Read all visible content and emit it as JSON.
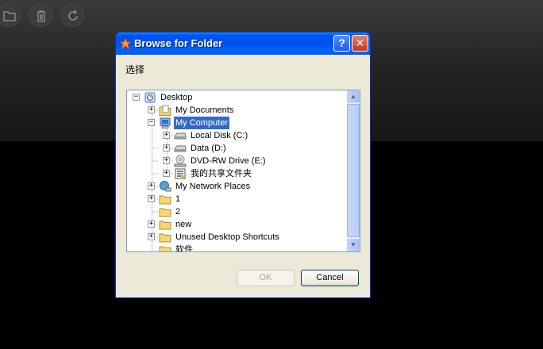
{
  "dialog": {
    "title": "Browse for Folder",
    "help_label": "?",
    "close_label": "✕",
    "prompt": "选择",
    "ok_label": "OK",
    "cancel_label": "Cancel"
  },
  "tree": [
    {
      "label": "Desktop",
      "expander": "−",
      "icon": "desktop-icon"
    },
    {
      "label": "My Documents",
      "expander": "+",
      "icon": "my-documents-icon"
    },
    {
      "label": "My Computer",
      "expander": "−",
      "icon": "my-computer-icon",
      "selected": true
    },
    {
      "label": "Local Disk (C:)",
      "expander": "+",
      "icon": "hard-drive-icon"
    },
    {
      "label": "Data (D:)",
      "expander": "+",
      "icon": "hard-drive-icon"
    },
    {
      "label": "DVD-RW Drive (E:)",
      "expander": "+",
      "icon": "dvd-drive-icon"
    },
    {
      "label": "我的共享文件夹",
      "expander": "+",
      "icon": "shared-folder-icon"
    },
    {
      "label": "My Network Places",
      "expander": "+",
      "icon": "network-places-icon"
    },
    {
      "label": "1",
      "expander": "+",
      "icon": "folder-icon"
    },
    {
      "label": "2",
      "expander": "",
      "icon": "folder-icon"
    },
    {
      "label": "new",
      "expander": "+",
      "icon": "folder-icon"
    },
    {
      "label": "Unused Desktop Shortcuts",
      "expander": "+",
      "icon": "folder-icon"
    },
    {
      "label": "软件",
      "expander": "",
      "icon": "folder-icon"
    }
  ],
  "top_icons": [
    "folder-icon",
    "trash-icon",
    "refresh-icon"
  ],
  "colors": {
    "selection": "#316ac5",
    "titlebar": "#0054e3",
    "dialog": "#ece9d8"
  }
}
